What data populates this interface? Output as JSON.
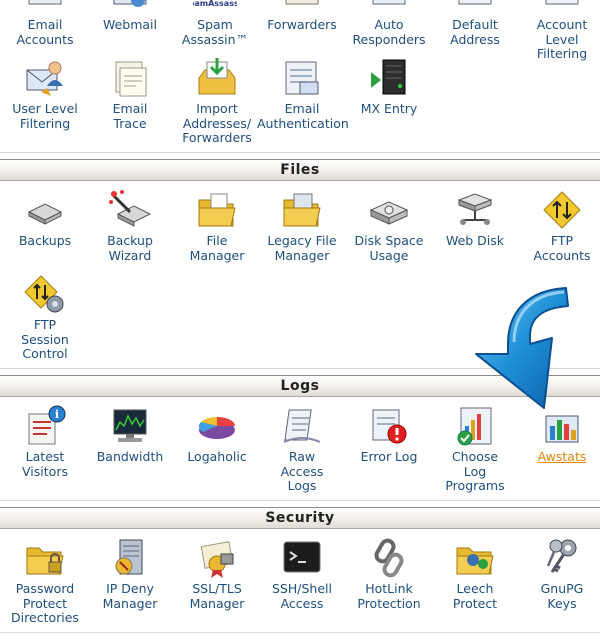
{
  "mail": {
    "row1": [
      "Email\nAccounts",
      "Webmail",
      "Spam\nAssassin™",
      "Forwarders",
      "Auto\nResponders",
      "Default\nAddress",
      "Account\nLevel\nFiltering"
    ],
    "spam_logo_text": "SpamAssassin",
    "row2": [
      "User Level\nFiltering",
      "Email\nTrace",
      "Import\nAddresses/\nForwarders",
      "Email\nAuthentication",
      "MX Entry"
    ]
  },
  "files": {
    "title": "Files",
    "items": [
      "Backups",
      "Backup\nWizard",
      "File\nManager",
      "Legacy File\nManager",
      "Disk Space\nUsage",
      "Web Disk",
      "FTP\nAccounts",
      "FTP\nSession\nControl"
    ]
  },
  "logs": {
    "title": "Logs",
    "items": [
      "Latest\nVisitors",
      "Bandwidth",
      "Logaholic",
      "Raw\nAccess\nLogs",
      "Error Log",
      "Choose\nLog\nPrograms",
      "Awstats"
    ]
  },
  "security": {
    "title": "Security",
    "items": [
      "Password\nProtect\nDirectories",
      "IP Deny\nManager",
      "SSL/TLS\nManager",
      "SSH/Shell\nAccess",
      "HotLink\nProtection",
      "Leech\nProtect",
      "GnuPG\nKeys"
    ]
  },
  "colors": {
    "link": "#1f4f7d",
    "active_link": "#e8860c",
    "arrow": "#1e8fd6"
  }
}
